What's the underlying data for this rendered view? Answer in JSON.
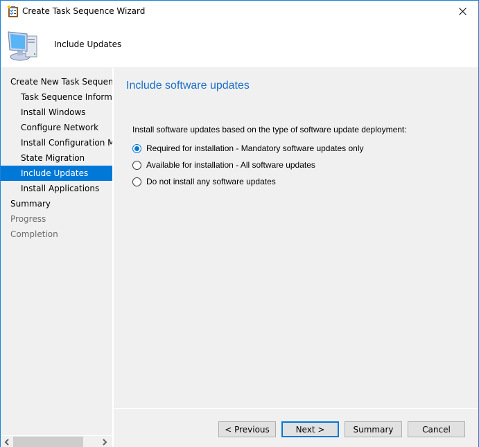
{
  "window": {
    "title": "Create Task Sequence Wizard",
    "close_label": "Close"
  },
  "header": {
    "title": "Include Updates"
  },
  "sidebar": {
    "items": [
      {
        "label": "Create New Task Sequence",
        "level": 0,
        "state": "normal"
      },
      {
        "label": "Task Sequence Information",
        "level": 1,
        "state": "normal"
      },
      {
        "label": "Install Windows",
        "level": 1,
        "state": "normal"
      },
      {
        "label": "Configure Network",
        "level": 1,
        "state": "normal"
      },
      {
        "label": "Install Configuration Manager",
        "level": 1,
        "state": "normal"
      },
      {
        "label": "State Migration",
        "level": 1,
        "state": "normal"
      },
      {
        "label": "Include Updates",
        "level": 1,
        "state": "active"
      },
      {
        "label": "Install Applications",
        "level": 1,
        "state": "normal"
      },
      {
        "label": "Summary",
        "level": 0,
        "state": "normal"
      },
      {
        "label": "Progress",
        "level": 0,
        "state": "disabled"
      },
      {
        "label": "Completion",
        "level": 0,
        "state": "disabled"
      }
    ]
  },
  "main": {
    "title": "Include software updates",
    "prompt": "Install software updates based on the type of software update deployment:",
    "options": [
      {
        "label": "Required for installation - Mandatory software updates only",
        "checked": true
      },
      {
        "label": "Available for installation - All software updates",
        "checked": false
      },
      {
        "label": "Do not install any software updates",
        "checked": false
      }
    ]
  },
  "buttons": {
    "previous": "< Previous",
    "next": "Next >",
    "summary": "Summary",
    "cancel": "Cancel"
  },
  "colors": {
    "accent": "#0078d7",
    "title_blue": "#1b6fc9",
    "disabled_text": "#6d6d6d",
    "background": "#f0f0f0"
  }
}
